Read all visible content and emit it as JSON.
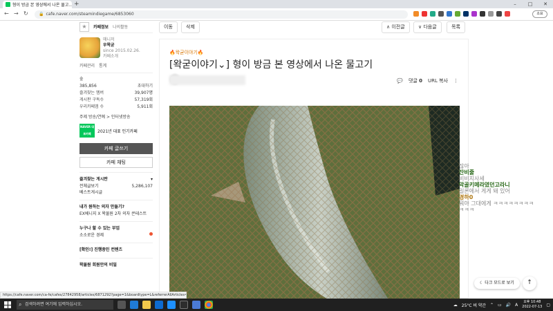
{
  "browser": {
    "tab_title": "형이 방금 본 영상에서 나온 물고...",
    "tab_close": "×",
    "new_tab": "+",
    "url": "cafe.naver.com/steamindiegame/6853060",
    "profile_label": "소요",
    "window_controls": [
      "–",
      "□",
      "✕"
    ],
    "nav_icons": [
      "←",
      "→",
      "↻"
    ]
  },
  "sidebar": {
    "tabs": [
      "카페정보",
      "나의활동"
    ],
    "manager_label": "매니저",
    "manager_name": "우왁굳",
    "since": "since 2015.02.26.",
    "cafe_intro": "카페소개",
    "links": [
      "카페관리",
      "통계"
    ],
    "level": "숲",
    "members": "385,856",
    "invite": "초대하기",
    "stats": [
      {
        "label": "즐겨찾는 멤버",
        "value": "39,907명"
      },
      {
        "label": "게시판 구독수",
        "value": "57,319회"
      },
      {
        "label": "우리카페앱 수",
        "value": "5,911회"
      }
    ],
    "topic_label": "주제",
    "topic_value": "방송/연예 > 인터넷방송",
    "naver_badge": "NAVER 대표카페",
    "badge_text": "2021년 대표 인기카페",
    "write_button": "카페 글쓰기",
    "chat_button": "카페 채팅",
    "fav_board_header": "즐겨찾는 게시판",
    "fav_boards": [
      {
        "label": "전체글보기",
        "value": "5,286,107"
      },
      {
        "label": "베스트게시글",
        "value": ""
      }
    ],
    "sections": [
      {
        "header": "내가 원하는 의자 만들기?",
        "item": "EX베니지 X 왁물원 2차 의자 콘테스트"
      },
      {
        "header": "누구나 할 수 있는 부업",
        "item": "소소로운 경제"
      },
      {
        "header": "[확인!] 진행중인 컨텐츠",
        "item": ""
      },
      {
        "header": "왁물원 회원만의 비밀",
        "item": ""
      }
    ]
  },
  "content": {
    "buttons": {
      "move": "이동",
      "delete": "삭제",
      "prev": "∧ 이전글",
      "next": "∨ 다음글",
      "list": "목록"
    },
    "category": "🔥왁굳이야기🔥",
    "title": "[왁굳이야기⌄] 형이 방금 본 영상에서 나온 물고기",
    "comment_label": "댓글",
    "comment_count": "0",
    "url_copy": "URL 복사",
    "more": "⋮"
  },
  "chat": [
    {
      "user": "",
      "msg": "잖아"
    },
    {
      "user": "잔비줄",
      "msg": "비비지사세"
    },
    {
      "user": "악골키메라였던고라니",
      "msg": "일론에서 게게 돼 있어"
    },
    {
      "user": "경하0",
      "msg": "뭐야 그대에게 ㅋㅋㅋㅋㅋㅋㅋㅋ"
    },
    {
      "user": "",
      "msg": "ㅋㅋㅋ"
    }
  ],
  "floating": {
    "dark_mode": "다크 모드로 보기",
    "top": "↑"
  },
  "status_url": "https://cafe.naver.com/ca-fe/cafes/27842958/articles/6871292?page=1&boardtype=L&referrerAllArticles=true&bol...",
  "taskbar": {
    "search_placeholder": "검색하려면 여기에 입력하십시오.",
    "weather": "25°C 비 약간",
    "ime": "A",
    "time": "오후 10:48",
    "date": "2022-07-13"
  }
}
